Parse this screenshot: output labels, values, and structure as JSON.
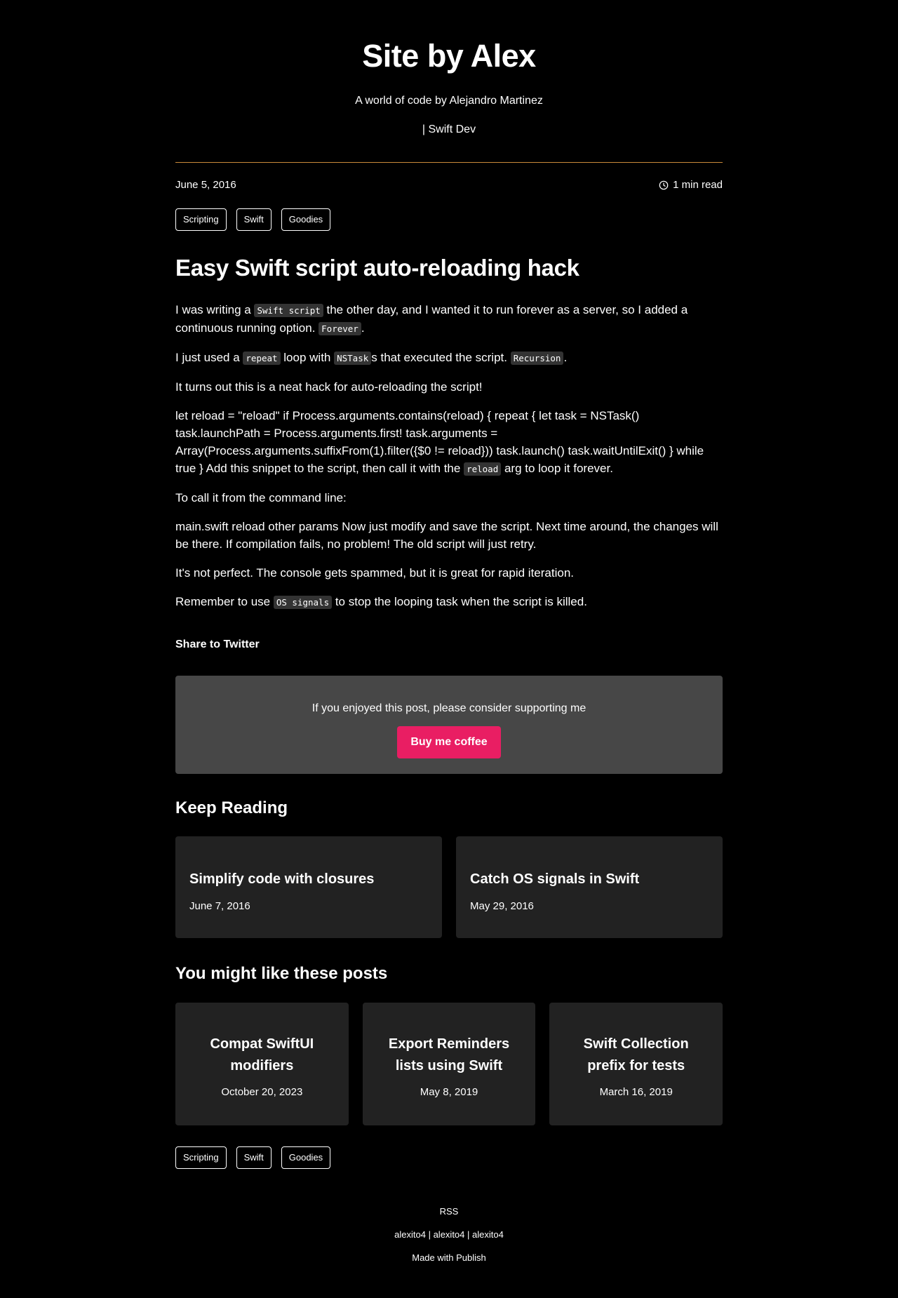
{
  "site": {
    "title": "Site by Alex",
    "description": "A world of code by Alejandro Martinez",
    "role": "| Swift Dev"
  },
  "post": {
    "date": "June 5, 2016",
    "read_time": "1 min read",
    "tags": [
      "Scripting",
      "Swift",
      "Goodies"
    ],
    "title": "Easy Swift script auto-reloading hack",
    "p1": {
      "t1": "I was writing a ",
      "c1": "Swift script",
      "t2": " the other day, and I wanted it to run forever as a server, so I added a continuous running option. ",
      "c2": "Forever",
      "t3": "."
    },
    "p2": {
      "t1": "I just used a ",
      "c1": "repeat",
      "t2": " loop with ",
      "c2": "NSTask",
      "t3": "s that executed the script. ",
      "c3": "Recursion",
      "t4": "."
    },
    "p3": "It turns out this is a neat hack for auto-reloading the script!",
    "p4": {
      "t1": "let reload = \"reload\" if Process.arguments.contains(reload) { repeat { let task = NSTask() task.launchPath = Process.arguments.first! task.arguments = Array(Process.arguments.suffixFrom(1).filter({$0 != reload})) task.launch() task.waitUntilExit() } while true } Add this snippet to the script, then call it with the ",
      "c1": "reload",
      "t2": " arg to loop it forever."
    },
    "p5": "To call it from the command line:",
    "p6": "main.swift reload other params Now just modify and save the script. Next time around, the changes will be there. If compilation fails, no problem! The old script will just retry.",
    "p7": "It's not perfect. The console gets spammed, but it is great for rapid iteration.",
    "p8": {
      "t1": "Remember to use ",
      "c1": "OS signals",
      "t2": " to stop the looping task when the script is killed."
    },
    "share_label": "Share to Twitter"
  },
  "support": {
    "text": "If you enjoyed this post, please consider supporting me",
    "button": "Buy me coffee",
    "button_color": "#e91e63"
  },
  "keep_reading": {
    "title": "Keep Reading",
    "items": [
      {
        "title": "Simplify code with closures",
        "date": "June 7, 2016"
      },
      {
        "title": "Catch OS signals in Swift",
        "date": "May 29, 2016"
      }
    ]
  },
  "you_might_like": {
    "title": "You might like these posts",
    "items": [
      {
        "title": "Compat SwiftUI modifiers",
        "date": "October 20, 2023"
      },
      {
        "title": "Export Reminders lists using Swift",
        "date": "May 8, 2019"
      },
      {
        "title": "Swift Collection prefix for tests",
        "date": "March 16, 2019"
      }
    ]
  },
  "footer": {
    "rss": "RSS",
    "social": "alexito4 | alexito4 | alexito4",
    "made_with": "Made with Publish"
  },
  "colors": {
    "background": "#000000",
    "divider": "#c9893a",
    "support_bg": "#474747",
    "card_bg": "#222222"
  }
}
